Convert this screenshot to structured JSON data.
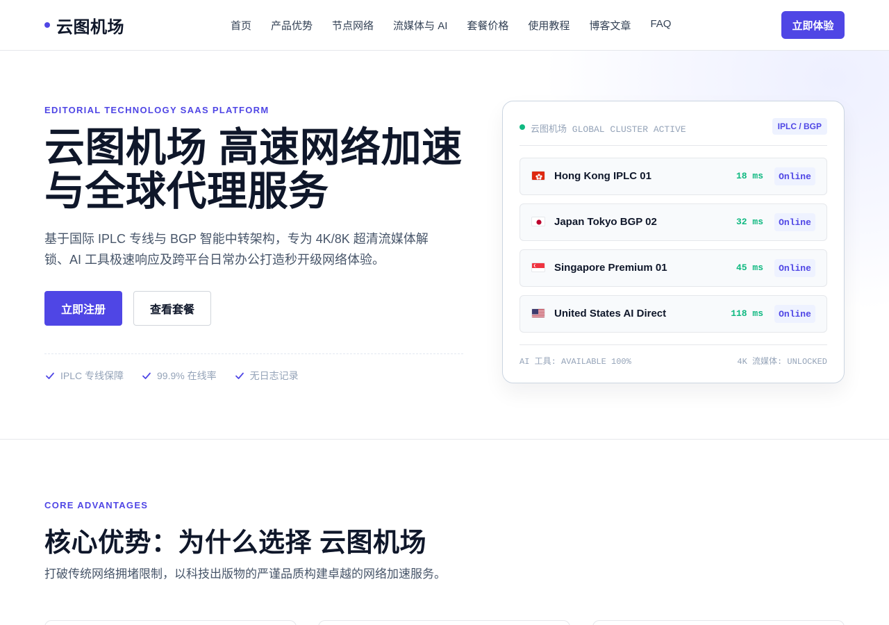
{
  "header": {
    "logo": "云图机场",
    "nav": [
      "首页",
      "产品优势",
      "节点网络",
      "流媒体与 AI",
      "套餐价格",
      "使用教程",
      "博客文章",
      "FAQ"
    ],
    "cta": "立即体验"
  },
  "hero": {
    "eyebrow": "EDITORIAL TECHNOLOGY SAAS PLATFORM",
    "title_line1": "云图机场 高速网络加速",
    "title_line2": "与全球代理服务",
    "description": "基于国际 IPLC 专线与 BGP 智能中转架构，专为 4K/8K 超清流媒体解锁、AI 工具极速响应及跨平台日常办公打造秒开级网络体验。",
    "primary_button": "立即注册",
    "secondary_button": "查看套餐",
    "checks": [
      "IPLC 专线保障",
      "99.9% 在线率",
      "无日志记录"
    ]
  },
  "status_card": {
    "status": "云图机场 GLOBAL CLUSTER ACTIVE",
    "tag": "IPLC / BGP",
    "status_color": "#10b981",
    "nodes": [
      {
        "flag": "hong-kong-flag-icon",
        "name": "Hong Kong IPLC 01",
        "latency": "18 ms",
        "status": "Online"
      },
      {
        "flag": "japan-flag-icon",
        "name": "Japan Tokyo BGP 02",
        "latency": "32 ms",
        "status": "Online"
      },
      {
        "flag": "singapore-flag-icon",
        "name": "Singapore Premium 01",
        "latency": "45 ms",
        "status": "Online"
      },
      {
        "flag": "united-states-flag-icon",
        "name": "United States AI Direct",
        "latency": "118 ms",
        "status": "Online"
      }
    ],
    "footer_left": "AI 工具: AVAILABLE 100%",
    "footer_right": "4K 流媒体: UNLOCKED"
  },
  "advantages": {
    "eyebrow": "CORE ADVANTAGES",
    "title": "核心优势：为什么选择 云图机场",
    "description": "打破传统网络拥堵限制，以科技出版物的严谨品质构建卓越的网络加速服务。"
  },
  "colors": {
    "accent": "#4f46e5",
    "success": "#10b981",
    "text": "#0f172a"
  }
}
